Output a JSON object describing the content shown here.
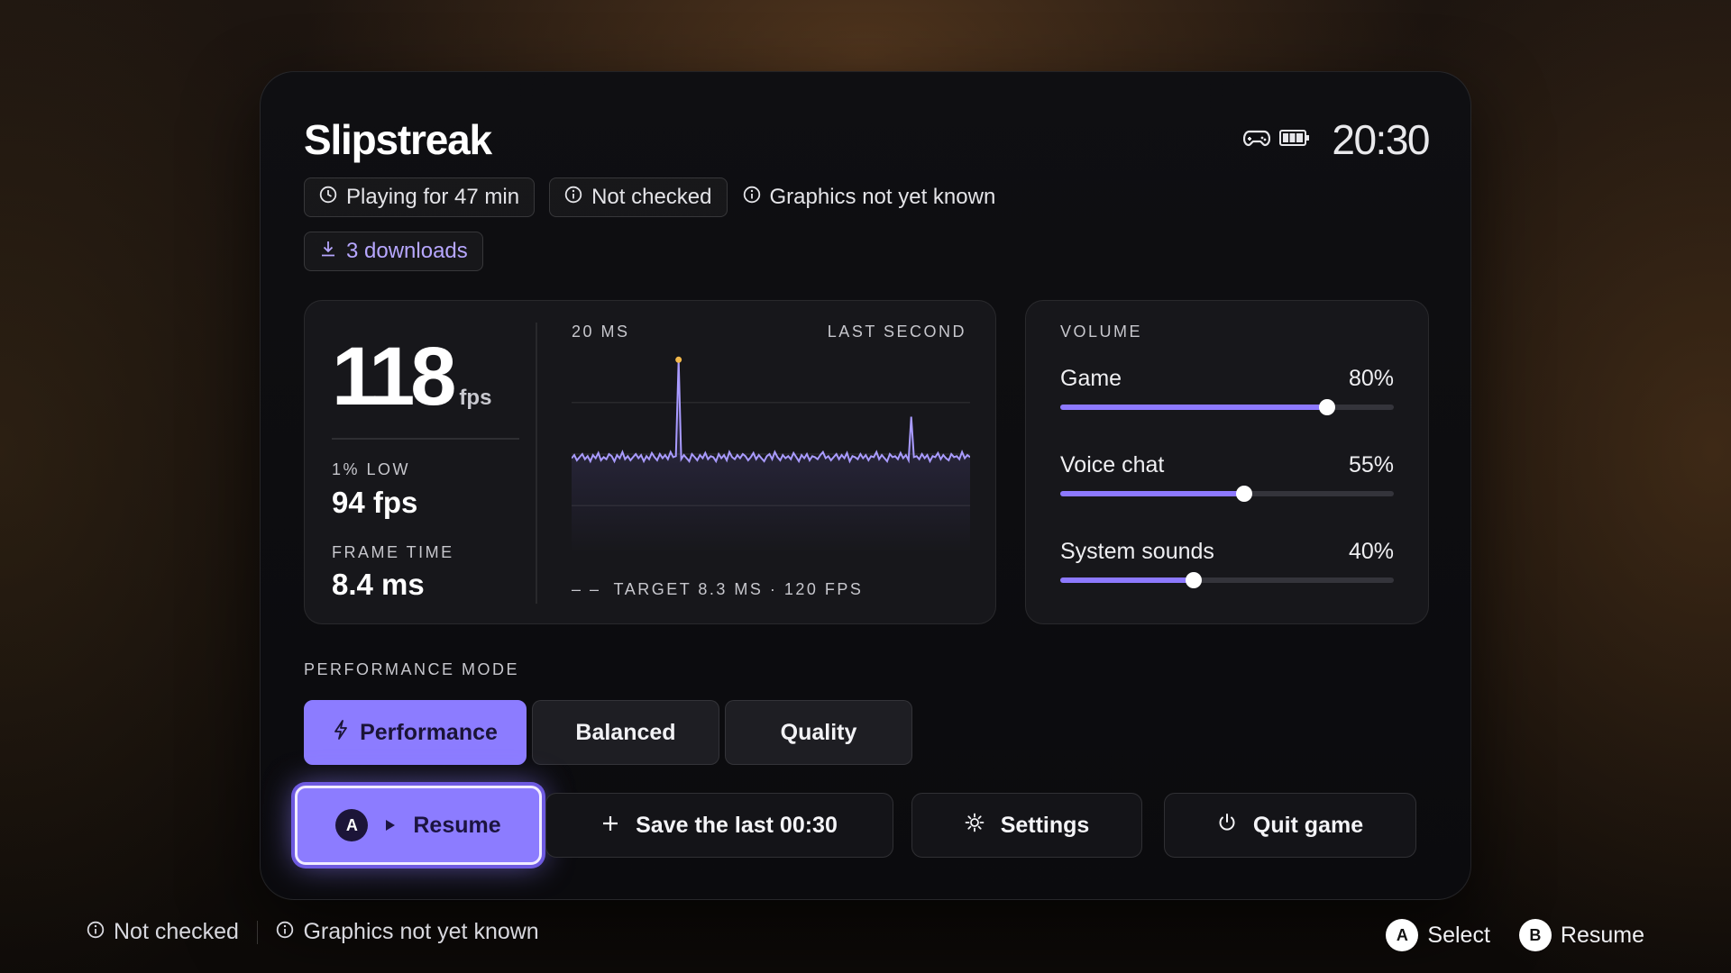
{
  "header": {
    "title": "Slipstreak",
    "clock": "20:30",
    "icons": [
      "gamepad-icon",
      "battery-icon"
    ]
  },
  "chips": {
    "playtime": "Playing for 47 min",
    "not_checked": "Not checked",
    "graphics": "Graphics not yet known",
    "downloads": "3 downloads"
  },
  "performance": {
    "fps": "118",
    "fps_unit": "fps",
    "low_label": "1% LOW",
    "low_value": "94 fps",
    "frametime_label": "FRAME TIME",
    "frametime_value": "8.4 ms",
    "graph_scale": "20 MS",
    "graph_window": "LAST SECOND",
    "target_marker": "– –",
    "target_label": "TARGET 8.3 MS · 120 FPS"
  },
  "chart_data": {
    "type": "line",
    "title": "",
    "xlabel": "",
    "ylabel": "",
    "y_unit": "ms",
    "ylim": [
      0,
      20
    ],
    "series": [
      {
        "values": [
          8.3,
          8.6,
          8.1,
          8.4,
          8.7,
          8.2,
          8.5,
          8.0,
          8.6,
          8.3,
          8.8,
          8.1,
          8.4,
          8.2,
          8.7,
          8.5,
          8.0,
          8.6,
          8.3,
          8.9,
          8.2,
          8.5,
          8.1,
          8.4,
          8.7,
          8.3,
          8.6,
          8.0,
          8.5,
          8.2,
          8.8,
          8.4,
          8.1,
          8.7,
          8.3,
          8.6,
          8.2,
          8.9,
          8.4,
          8.5,
          17.8,
          8.2,
          8.6,
          8.3,
          8.0,
          8.7,
          8.4,
          8.1,
          8.6,
          8.3,
          8.8,
          8.2,
          8.5,
          8.4,
          8.0,
          8.7,
          8.3,
          8.6,
          8.1,
          8.9,
          8.4,
          8.2,
          8.6,
          8.3,
          8.7,
          8.5,
          8.1,
          8.4,
          8.8,
          8.2,
          8.6,
          8.3,
          8.0,
          8.5,
          8.7,
          8.2,
          8.9,
          8.4,
          8.1,
          8.6,
          8.3,
          8.5,
          8.2,
          8.8,
          8.4,
          8.0,
          8.6,
          8.3,
          8.7,
          8.1,
          8.5,
          8.4,
          8.2,
          8.6,
          8.9,
          8.3,
          8.5,
          8.1,
          8.4,
          8.7,
          8.2,
          8.6,
          8.3,
          8.8,
          8.0,
          8.5,
          8.4,
          8.2,
          8.7,
          8.3,
          8.6,
          8.1,
          8.5,
          8.4,
          8.9,
          8.2,
          8.6,
          8.3,
          8.0,
          8.7,
          8.4,
          8.5,
          8.2,
          8.8,
          8.3,
          8.6,
          8.1,
          12.3,
          8.4,
          8.5,
          8.2,
          8.7,
          8.3,
          8.6,
          8.0,
          8.5,
          8.4,
          8.8,
          8.2,
          8.6,
          8.3,
          8.1,
          8.7,
          8.4,
          8.5,
          8.2,
          8.9,
          8.3,
          8.6,
          8.4
        ]
      }
    ],
    "target": 8.3,
    "peak_marker_color": "#f2b84b",
    "line_color": "#a99bff",
    "grid": true
  },
  "volume": {
    "title": "VOLUME",
    "sliders": [
      {
        "label": "Game",
        "value_text": "80%",
        "value": 0.8
      },
      {
        "label": "Voice chat",
        "value_text": "55%",
        "value": 0.55
      },
      {
        "label": "System sounds",
        "value_text": "40%",
        "value": 0.4
      }
    ]
  },
  "modes": {
    "label": "PERFORMANCE MODE",
    "performance": "Performance",
    "balanced": "Balanced",
    "quality": "Quality",
    "selected": "Performance"
  },
  "actions": {
    "resume_badge": "A",
    "resume": "Resume",
    "save": "Save the last 00:30",
    "settings": "Settings",
    "quit": "Quit game"
  },
  "footer": {
    "not_checked": "Not checked",
    "graphics": "Graphics not yet known",
    "select_badge": "A",
    "select": "Select",
    "resume_badge": "B",
    "resume": "Resume"
  },
  "colors": {
    "accent": "#8c7cff",
    "slider_fill": "#8d79ff",
    "downloads_text": "#b7a7ff"
  }
}
